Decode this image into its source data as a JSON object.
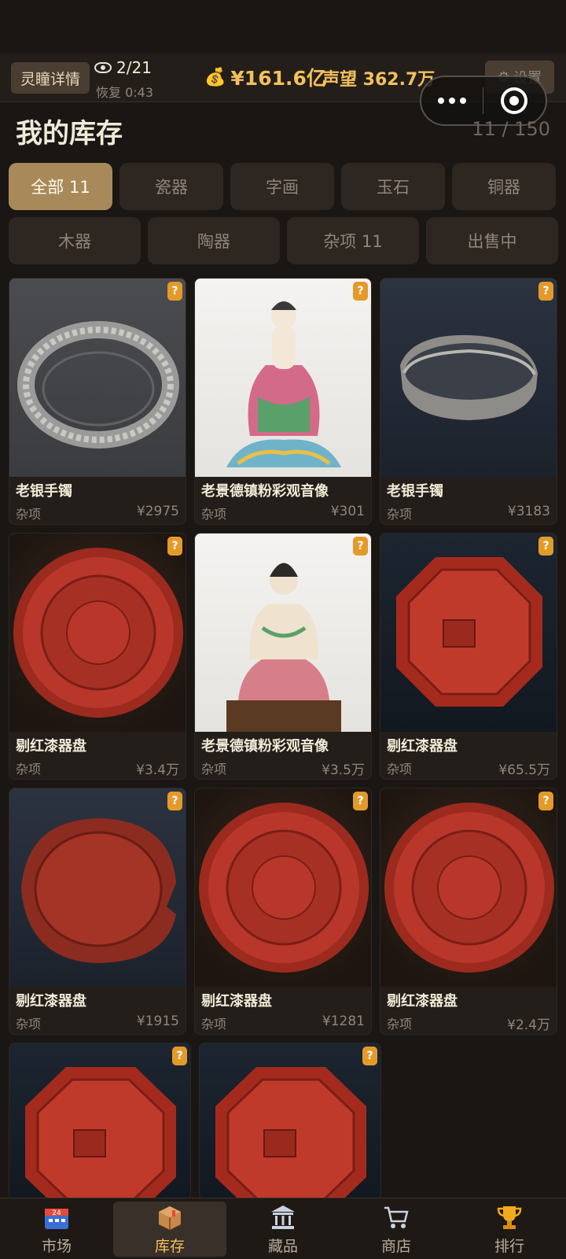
{
  "header": {
    "eye_button": "灵瞳详情",
    "eye_count": "2/21",
    "recover": "恢复 0:43",
    "money": "¥161.6亿",
    "fame": "声望 362.7万",
    "settings": "设置"
  },
  "page": {
    "title": "我的库存",
    "count": "11 / 150"
  },
  "tabs_row1": [
    {
      "label": "全部 11",
      "active": true
    },
    {
      "label": "瓷器"
    },
    {
      "label": "字画"
    },
    {
      "label": "玉石"
    },
    {
      "label": "铜器"
    }
  ],
  "tabs_row2": [
    {
      "label": "木器"
    },
    {
      "label": "陶器"
    },
    {
      "label": "杂项 11"
    },
    {
      "label": "出售中"
    }
  ],
  "items": [
    {
      "name": "老银手镯",
      "category": "杂项",
      "price": "¥2975",
      "badge": "?",
      "image": "silver-bangle"
    },
    {
      "name": "老景德镇粉彩观音像",
      "category": "杂项",
      "price": "¥301",
      "badge": "?",
      "image": "guanyin-statue"
    },
    {
      "name": "老银手镯",
      "category": "杂项",
      "price": "¥3183",
      "badge": "?",
      "image": "silver-bangle-worn"
    },
    {
      "name": "剔红漆器盘",
      "category": "杂项",
      "price": "¥3.4万",
      "badge": "?",
      "image": "lacquer-round-plate"
    },
    {
      "name": "老景德镇粉彩观音像",
      "category": "杂项",
      "price": "¥3.5万",
      "badge": "?",
      "image": "guanyin-statue-seated"
    },
    {
      "name": "剔红漆器盘",
      "category": "杂项",
      "price": "¥65.5万",
      "badge": "?",
      "image": "lacquer-octagon-plate"
    },
    {
      "name": "剔红漆器盘",
      "category": "杂项",
      "price": "¥1915",
      "badge": "?",
      "image": "lacquer-plate-broken"
    },
    {
      "name": "剔红漆器盘",
      "category": "杂项",
      "price": "¥1281",
      "badge": "?",
      "image": "lacquer-round-plate"
    },
    {
      "name": "剔红漆器盘",
      "category": "杂项",
      "price": "¥2.4万",
      "badge": "?",
      "image": "lacquer-round-plate"
    },
    {
      "badge": "?",
      "image": "lacquer-octagon-plate"
    },
    {
      "badge": "?",
      "image": "lacquer-octagon-plate"
    }
  ],
  "nav": [
    {
      "label": "市场",
      "icon": "market-calendar-icon"
    },
    {
      "label": "库存",
      "icon": "box-icon",
      "active": true
    },
    {
      "label": "藏品",
      "icon": "museum-icon"
    },
    {
      "label": "商店",
      "icon": "cart-icon"
    },
    {
      "label": "排行",
      "icon": "trophy-icon"
    }
  ],
  "colors": {
    "accent": "#f2c15c",
    "active_tab": "#a88a5a",
    "badge": "#e39a2a",
    "lacquer": "#b32d20"
  }
}
